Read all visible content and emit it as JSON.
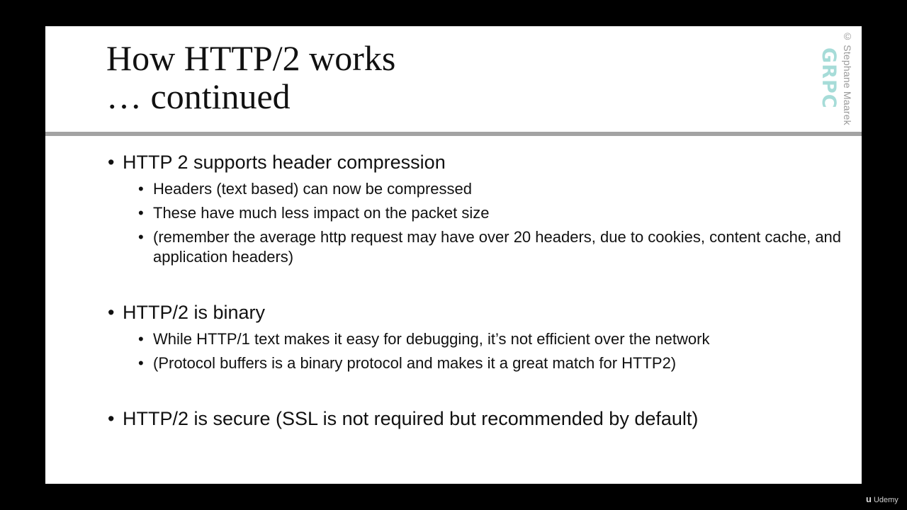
{
  "slide": {
    "title_line1": "How HTTP/2 works",
    "title_line2": "… continued",
    "watermark": "© Stephane Maarek",
    "logo_text": "GRPC",
    "groups": [
      {
        "main": "HTTP 2 supports header compression",
        "subs": [
          "Headers (text based) can now be compressed",
          "These have much less impact on the packet size",
          "(remember the average http request may have over 20 headers, due to cookies, content cache, and application headers)"
        ]
      },
      {
        "main": "HTTP/2 is binary",
        "subs": [
          "While HTTP/1 text makes it easy for debugging, it’s not efficient over the network",
          "(Protocol buffers is a binary protocol and makes it a great match for HTTP2)"
        ]
      },
      {
        "main": "HTTP/2 is secure (SSL is not required but recommended by default)",
        "subs": []
      }
    ]
  },
  "footer": {
    "brand_mark": "u",
    "brand": "Udemy"
  },
  "colors": {
    "background": "#000000",
    "slide": "#ffffff",
    "divider": "#a3a3a3",
    "logo": "#a6dcd8"
  }
}
